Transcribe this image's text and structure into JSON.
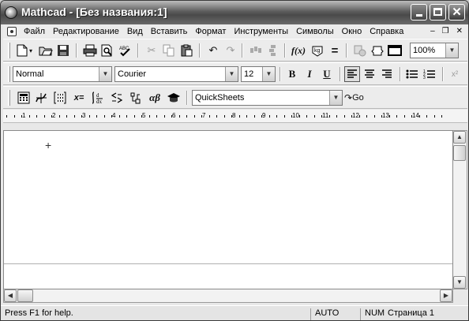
{
  "window": {
    "title": "Mathcad - [Без названия:1]",
    "controls": [
      "minimize",
      "maximize",
      "close"
    ]
  },
  "menubar": {
    "items": [
      "Файл",
      "Редактирование",
      "Вид",
      "Вставить",
      "Формат",
      "Инструменты",
      "Символы",
      "Окно",
      "Справка"
    ],
    "mdi_controls": [
      "–",
      "❐",
      "✕"
    ]
  },
  "standard_toolbar": {
    "zoom": "100%"
  },
  "formatting_toolbar": {
    "style": "Normal",
    "font": "Courier",
    "size": "12",
    "bold_label": "B",
    "italic_label": "I",
    "underline_label": "U",
    "superscript_label": "x²"
  },
  "math_toolbar": {
    "calc_eq_label": "x=",
    "greek_label": "αβ",
    "resources_combo": "QuickSheets",
    "go_label": "Go"
  },
  "ruler": {
    "numbers": [
      "1",
      "2",
      "3",
      "4",
      "5",
      "6",
      "7",
      "8",
      "9",
      "10",
      "11",
      "12",
      "13",
      "14"
    ]
  },
  "worksheet": {
    "cursor": "+"
  },
  "statusbar": {
    "help": "Press F1 for help.",
    "mode": "AUTO",
    "num": "NUM",
    "page": "Страница 1"
  }
}
